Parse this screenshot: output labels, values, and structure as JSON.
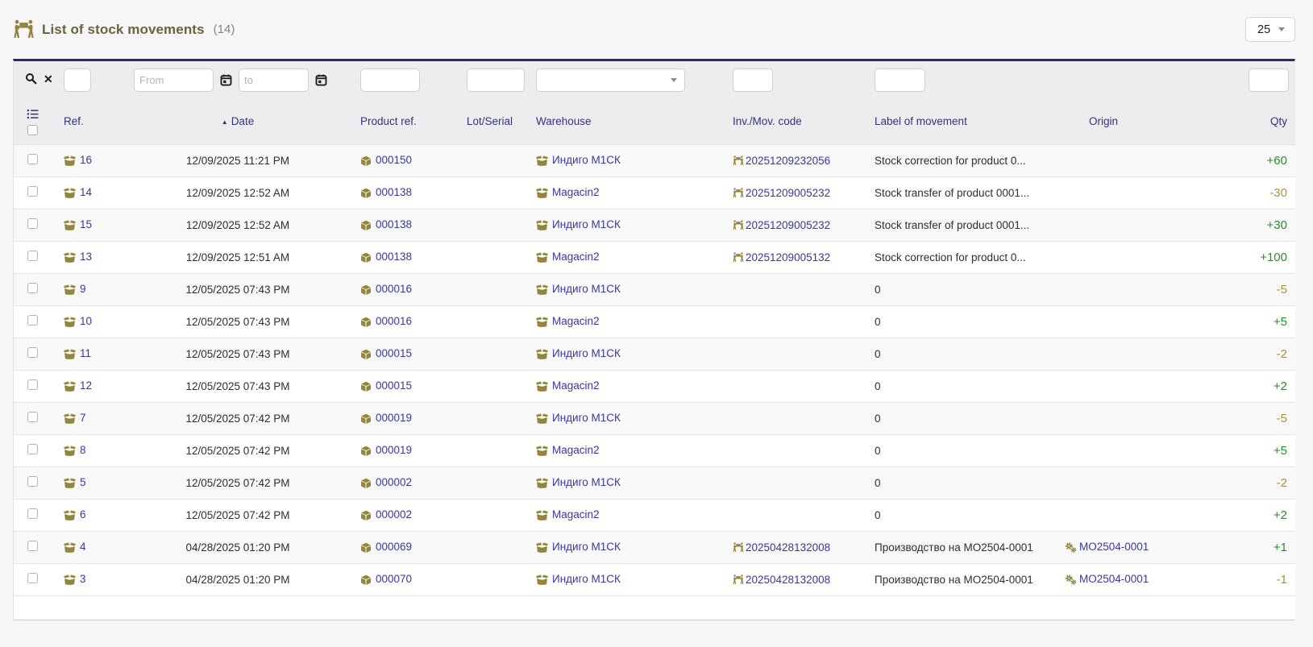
{
  "header": {
    "title": "List of stock movements",
    "count": "(14)",
    "page_size": "25"
  },
  "filter": {
    "from_placeholder": "From",
    "to_placeholder": "to"
  },
  "sort": {
    "column": "Date",
    "direction": "asc",
    "indicator": "▲"
  },
  "columns": {
    "ref": "Ref.",
    "date": "Date",
    "product": "Product ref.",
    "lot": "Lot/Serial",
    "warehouse": "Warehouse",
    "inv": "Inv./Mov. code",
    "label": "Label of movement",
    "origin": "Origin",
    "qty": "Qty"
  },
  "icons": {
    "title_icon": "people-carry",
    "ref_icon": "open-box",
    "product_icon": "cube",
    "warehouse_icon": "open-box",
    "movement_code_icon": "people-carry",
    "origin_icon": "gears",
    "filter_search": "magnifier",
    "filter_clear": "x-mark",
    "date_picker": "calendar",
    "columns_selector": "list-bullets",
    "page_size_dropdown": "caret-down"
  },
  "colors": {
    "accent_gold": "#93843e",
    "link_navy": "#3838a0",
    "header_navy": "#32327d",
    "top_border_navy": "#2a2a66",
    "positive_green": "#2e8b2e",
    "negative_gold": "#a6953e"
  },
  "table": {
    "rows": [
      {
        "ref": "16",
        "date": "12/09/2025 11:21 PM",
        "product": "000150",
        "lot": "",
        "warehouse": "Индиго М1СК",
        "inv_code": "20251209232056",
        "label": "Stock correction for product 0...",
        "origin": "",
        "qty": "+60"
      },
      {
        "ref": "14",
        "date": "12/09/2025 12:52 AM",
        "product": "000138",
        "lot": "",
        "warehouse": "Magacin2",
        "inv_code": "20251209005232",
        "label": "Stock transfer of product 0001...",
        "origin": "",
        "qty": "-30"
      },
      {
        "ref": "15",
        "date": "12/09/2025 12:52 AM",
        "product": "000138",
        "lot": "",
        "warehouse": "Индиго М1СК",
        "inv_code": "20251209005232",
        "label": "Stock transfer of product 0001...",
        "origin": "",
        "qty": "+30"
      },
      {
        "ref": "13",
        "date": "12/09/2025 12:51 AM",
        "product": "000138",
        "lot": "",
        "warehouse": "Magacin2",
        "inv_code": "20251209005132",
        "label": "Stock correction for product 0...",
        "origin": "",
        "qty": "+100"
      },
      {
        "ref": "9",
        "date": "12/05/2025 07:43 PM",
        "product": "000016",
        "lot": "",
        "warehouse": "Индиго М1СК",
        "inv_code": "",
        "label": "0",
        "origin": "",
        "qty": "-5"
      },
      {
        "ref": "10",
        "date": "12/05/2025 07:43 PM",
        "product": "000016",
        "lot": "",
        "warehouse": "Magacin2",
        "inv_code": "",
        "label": "0",
        "origin": "",
        "qty": "+5"
      },
      {
        "ref": "11",
        "date": "12/05/2025 07:43 PM",
        "product": "000015",
        "lot": "",
        "warehouse": "Индиго М1СК",
        "inv_code": "",
        "label": "0",
        "origin": "",
        "qty": "-2"
      },
      {
        "ref": "12",
        "date": "12/05/2025 07:43 PM",
        "product": "000015",
        "lot": "",
        "warehouse": "Magacin2",
        "inv_code": "",
        "label": "0",
        "origin": "",
        "qty": "+2"
      },
      {
        "ref": "7",
        "date": "12/05/2025 07:42 PM",
        "product": "000019",
        "lot": "",
        "warehouse": "Индиго М1СК",
        "inv_code": "",
        "label": "0",
        "origin": "",
        "qty": "-5"
      },
      {
        "ref": "8",
        "date": "12/05/2025 07:42 PM",
        "product": "000019",
        "lot": "",
        "warehouse": "Magacin2",
        "inv_code": "",
        "label": "0",
        "origin": "",
        "qty": "+5"
      },
      {
        "ref": "5",
        "date": "12/05/2025 07:42 PM",
        "product": "000002",
        "lot": "",
        "warehouse": "Индиго М1СК",
        "inv_code": "",
        "label": "0",
        "origin": "",
        "qty": "-2"
      },
      {
        "ref": "6",
        "date": "12/05/2025 07:42 PM",
        "product": "000002",
        "lot": "",
        "warehouse": "Magacin2",
        "inv_code": "",
        "label": "0",
        "origin": "",
        "qty": "+2"
      },
      {
        "ref": "4",
        "date": "04/28/2025 01:20 PM",
        "product": "000069",
        "lot": "",
        "warehouse": "Индиго М1СК",
        "inv_code": "20250428132008",
        "label": "Производство на MO2504-0001",
        "origin": "MO2504-0001",
        "qty": "+1"
      },
      {
        "ref": "3",
        "date": "04/28/2025 01:20 PM",
        "product": "000070",
        "lot": "",
        "warehouse": "Индиго М1СК",
        "inv_code": "20250428132008",
        "label": "Производство на MO2504-0001",
        "origin": "MO2504-0001",
        "qty": "-1"
      }
    ]
  }
}
